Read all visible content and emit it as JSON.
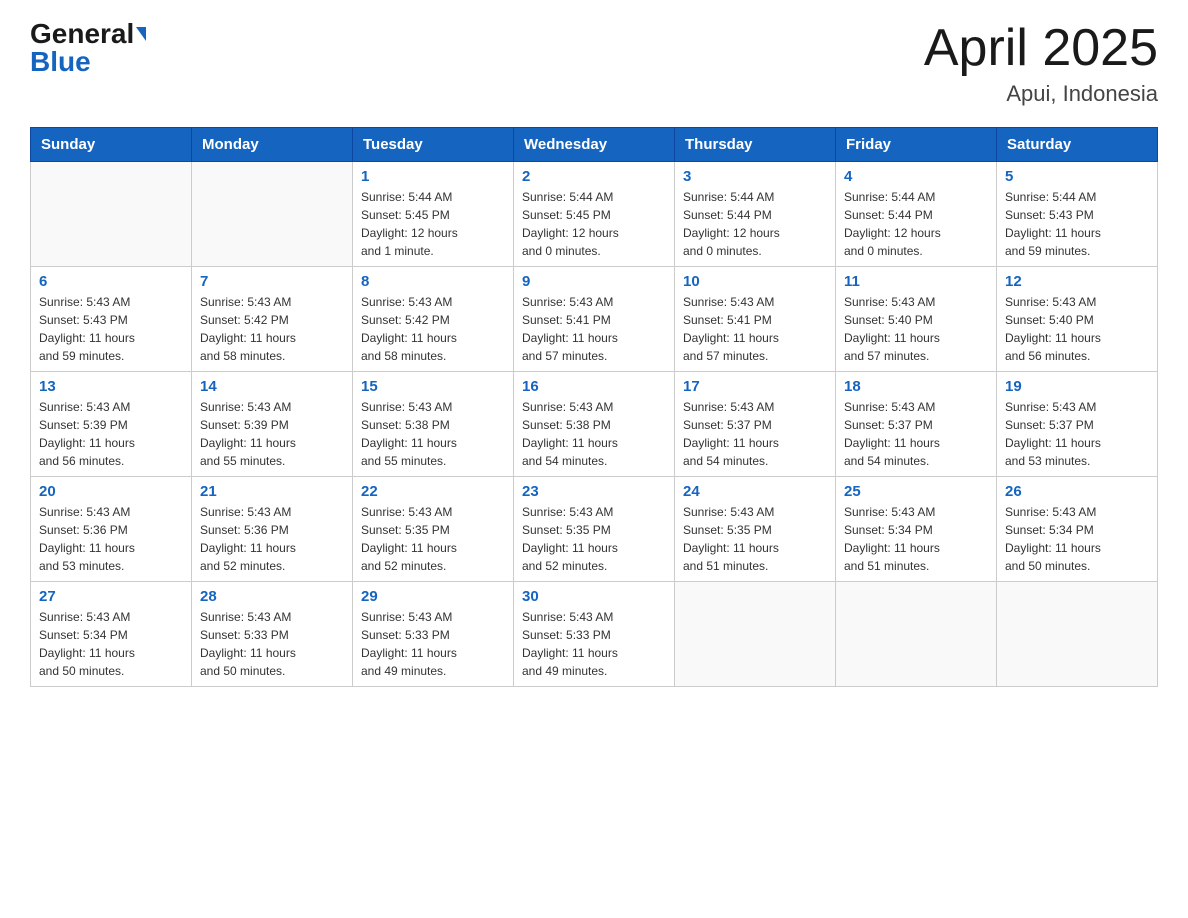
{
  "header": {
    "logo_general": "General",
    "logo_blue": "Blue",
    "month_title": "April 2025",
    "location": "Apui, Indonesia"
  },
  "weekdays": [
    "Sunday",
    "Monday",
    "Tuesday",
    "Wednesday",
    "Thursday",
    "Friday",
    "Saturday"
  ],
  "weeks": [
    [
      {
        "day": "",
        "info": ""
      },
      {
        "day": "",
        "info": ""
      },
      {
        "day": "1",
        "info": "Sunrise: 5:44 AM\nSunset: 5:45 PM\nDaylight: 12 hours\nand 1 minute."
      },
      {
        "day": "2",
        "info": "Sunrise: 5:44 AM\nSunset: 5:45 PM\nDaylight: 12 hours\nand 0 minutes."
      },
      {
        "day": "3",
        "info": "Sunrise: 5:44 AM\nSunset: 5:44 PM\nDaylight: 12 hours\nand 0 minutes."
      },
      {
        "day": "4",
        "info": "Sunrise: 5:44 AM\nSunset: 5:44 PM\nDaylight: 12 hours\nand 0 minutes."
      },
      {
        "day": "5",
        "info": "Sunrise: 5:44 AM\nSunset: 5:43 PM\nDaylight: 11 hours\nand 59 minutes."
      }
    ],
    [
      {
        "day": "6",
        "info": "Sunrise: 5:43 AM\nSunset: 5:43 PM\nDaylight: 11 hours\nand 59 minutes."
      },
      {
        "day": "7",
        "info": "Sunrise: 5:43 AM\nSunset: 5:42 PM\nDaylight: 11 hours\nand 58 minutes."
      },
      {
        "day": "8",
        "info": "Sunrise: 5:43 AM\nSunset: 5:42 PM\nDaylight: 11 hours\nand 58 minutes."
      },
      {
        "day": "9",
        "info": "Sunrise: 5:43 AM\nSunset: 5:41 PM\nDaylight: 11 hours\nand 57 minutes."
      },
      {
        "day": "10",
        "info": "Sunrise: 5:43 AM\nSunset: 5:41 PM\nDaylight: 11 hours\nand 57 minutes."
      },
      {
        "day": "11",
        "info": "Sunrise: 5:43 AM\nSunset: 5:40 PM\nDaylight: 11 hours\nand 57 minutes."
      },
      {
        "day": "12",
        "info": "Sunrise: 5:43 AM\nSunset: 5:40 PM\nDaylight: 11 hours\nand 56 minutes."
      }
    ],
    [
      {
        "day": "13",
        "info": "Sunrise: 5:43 AM\nSunset: 5:39 PM\nDaylight: 11 hours\nand 56 minutes."
      },
      {
        "day": "14",
        "info": "Sunrise: 5:43 AM\nSunset: 5:39 PM\nDaylight: 11 hours\nand 55 minutes."
      },
      {
        "day": "15",
        "info": "Sunrise: 5:43 AM\nSunset: 5:38 PM\nDaylight: 11 hours\nand 55 minutes."
      },
      {
        "day": "16",
        "info": "Sunrise: 5:43 AM\nSunset: 5:38 PM\nDaylight: 11 hours\nand 54 minutes."
      },
      {
        "day": "17",
        "info": "Sunrise: 5:43 AM\nSunset: 5:37 PM\nDaylight: 11 hours\nand 54 minutes."
      },
      {
        "day": "18",
        "info": "Sunrise: 5:43 AM\nSunset: 5:37 PM\nDaylight: 11 hours\nand 54 minutes."
      },
      {
        "day": "19",
        "info": "Sunrise: 5:43 AM\nSunset: 5:37 PM\nDaylight: 11 hours\nand 53 minutes."
      }
    ],
    [
      {
        "day": "20",
        "info": "Sunrise: 5:43 AM\nSunset: 5:36 PM\nDaylight: 11 hours\nand 53 minutes."
      },
      {
        "day": "21",
        "info": "Sunrise: 5:43 AM\nSunset: 5:36 PM\nDaylight: 11 hours\nand 52 minutes."
      },
      {
        "day": "22",
        "info": "Sunrise: 5:43 AM\nSunset: 5:35 PM\nDaylight: 11 hours\nand 52 minutes."
      },
      {
        "day": "23",
        "info": "Sunrise: 5:43 AM\nSunset: 5:35 PM\nDaylight: 11 hours\nand 52 minutes."
      },
      {
        "day": "24",
        "info": "Sunrise: 5:43 AM\nSunset: 5:35 PM\nDaylight: 11 hours\nand 51 minutes."
      },
      {
        "day": "25",
        "info": "Sunrise: 5:43 AM\nSunset: 5:34 PM\nDaylight: 11 hours\nand 51 minutes."
      },
      {
        "day": "26",
        "info": "Sunrise: 5:43 AM\nSunset: 5:34 PM\nDaylight: 11 hours\nand 50 minutes."
      }
    ],
    [
      {
        "day": "27",
        "info": "Sunrise: 5:43 AM\nSunset: 5:34 PM\nDaylight: 11 hours\nand 50 minutes."
      },
      {
        "day": "28",
        "info": "Sunrise: 5:43 AM\nSunset: 5:33 PM\nDaylight: 11 hours\nand 50 minutes."
      },
      {
        "day": "29",
        "info": "Sunrise: 5:43 AM\nSunset: 5:33 PM\nDaylight: 11 hours\nand 49 minutes."
      },
      {
        "day": "30",
        "info": "Sunrise: 5:43 AM\nSunset: 5:33 PM\nDaylight: 11 hours\nand 49 minutes."
      },
      {
        "day": "",
        "info": ""
      },
      {
        "day": "",
        "info": ""
      },
      {
        "day": "",
        "info": ""
      }
    ]
  ]
}
